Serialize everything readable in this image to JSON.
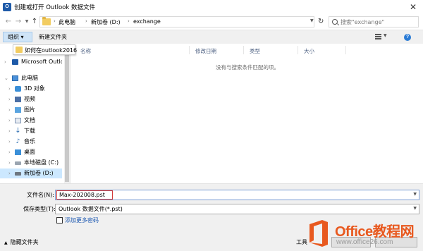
{
  "window": {
    "app_icon_text": "O",
    "title": "创建或打开 Outlook 数据文件",
    "close_glyph": "✕"
  },
  "address_bar": {
    "breadcrumbs": [
      "此电脑",
      "新加卷 (D:)",
      "exchange"
    ],
    "search_placeholder": "搜索\"exchange\""
  },
  "toolbar": {
    "organize_label": "组织 ▾",
    "new_folder_label": "新建文件夹"
  },
  "drag_tooltip": {
    "label": "如何在outlook2016"
  },
  "nav_tree": {
    "items": [
      {
        "label": "Microsoft Outlook",
        "icon": "outlook-icon"
      },
      {
        "label": "此电脑",
        "icon": "computer-icon"
      },
      {
        "label": "3D 对象",
        "icon": "3d-objects-icon"
      },
      {
        "label": "视频",
        "icon": "video-icon"
      },
      {
        "label": "图片",
        "icon": "pictures-icon"
      },
      {
        "label": "文档",
        "icon": "documents-icon"
      },
      {
        "label": "下载",
        "icon": "download-icon"
      },
      {
        "label": "音乐",
        "icon": "music-icon"
      },
      {
        "label": "桌面",
        "icon": "desktop-icon"
      },
      {
        "label": "本地磁盘 (C:)",
        "icon": "drive-icon"
      },
      {
        "label": "新加卷 (D:)",
        "icon": "drive-icon"
      }
    ]
  },
  "file_list": {
    "columns": [
      "名称",
      "修改日期",
      "类型",
      "大小"
    ],
    "empty_message": "没有与搜索条件匹配的项。"
  },
  "form": {
    "filename_label": "文件名(N):",
    "filename_value": "Max-202008.pst",
    "filetype_label": "保存类型(T):",
    "filetype_value": "Outlook 数据文件(*.pst)",
    "more_options_label": "添加更多密码",
    "hide_folders_label": "隐藏文件夹",
    "tools_label": "工具"
  },
  "watermark": {
    "brand": "Office教程网",
    "url": "www.office26.com"
  },
  "colors": {
    "accent": "#1e5aa8",
    "highlight": "#d23a3a",
    "watermark_orange": "#e8591f"
  }
}
